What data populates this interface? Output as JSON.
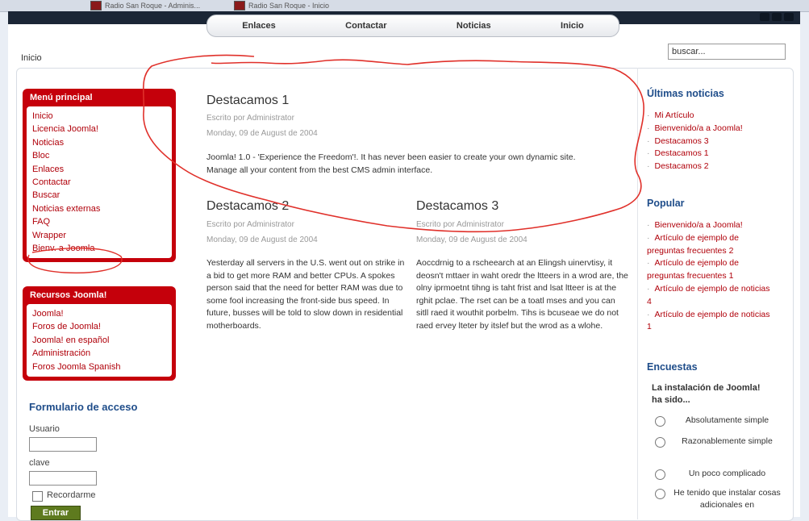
{
  "browser": {
    "tabs": [
      {
        "label": "Radio San Roque - Adminis..."
      },
      {
        "label": "Radio San Roque - Inicio"
      }
    ]
  },
  "nav": {
    "items": [
      "Enlaces",
      "Contactar",
      "Noticias",
      "Inicio"
    ]
  },
  "breadcrumb": "Inicio",
  "search": {
    "value": "buscar..."
  },
  "menu_principal": {
    "title": "Menú principal",
    "items": [
      "Inicio",
      "Licencia Joomla!",
      "Noticias",
      "Bloc",
      "Enlaces",
      "Contactar",
      "Buscar",
      "Noticias externas",
      "FAQ",
      "Wrapper",
      "Bienv. a Joomla"
    ]
  },
  "recursos": {
    "title": "Recursos Joomla!",
    "items": [
      "Joomla!",
      "Foros de Joomla!",
      "Joomla! en español",
      "Administración",
      "Foros Joomla Spanish"
    ]
  },
  "login": {
    "title": "Formulario de acceso",
    "user_label": "Usuario",
    "pass_label": "clave",
    "remember_label": "Recordarme",
    "submit_label": "Entrar"
  },
  "articles": [
    {
      "title": "Destacamos 1",
      "author": "Escrito por Administrator",
      "date": "Monday, 09 de August de 2004",
      "text": "Joomla! 1.0 - 'Experience the Freedom'!. It has never been easier to create your own dynamic site. Manage all your content from the best CMS admin interface."
    },
    {
      "title": "Destacamos 2",
      "author": "Escrito por Administrator",
      "date": "Monday, 09 de August de 2004",
      "text": "Yesterday all servers in the U.S. went out on strike in a bid to get more RAM and better CPUs. A spokes person said that the need for better RAM was due to some fool increasing the front-side bus speed. In future, busses will be told to slow down in residential motherboards."
    },
    {
      "title": "Destacamos 3",
      "author": "Escrito por Administrator",
      "date": "Monday, 09 de August de 2004",
      "text": "Aoccdrnig to a rscheearch at an Elingsh uinervtisy, it deosn't mttaer in waht oredr the ltteers in a wrod are, the olny iprmoetnt tihng is taht frist and lsat ltteer is at the rghit pclae. The rset can be a toatl mses and you can sitll raed it wouthit porbelm. Tihs is bcuseae we do not raed ervey lteter by itslef but the wrod as a wlohe."
    }
  ],
  "ultimas": {
    "title": "Últimas noticias",
    "items": [
      "Mi Artículo",
      "Bienvenido/a a Joomla!",
      "Destacamos 3",
      "Destacamos 1",
      "Destacamos 2"
    ]
  },
  "popular": {
    "title": "Popular",
    "items": [
      "Bienvenido/a a Joomla!",
      "Artículo de ejemplo de preguntas frecuentes 2",
      "Artículo de ejemplo de preguntas frecuentes 1",
      "Artículo de ejemplo de noticias 4",
      "Artículo de ejemplo de noticias 1"
    ]
  },
  "encuestas": {
    "title": "Encuestas",
    "question": "La instalación de Joomla! ha sido...",
    "options": [
      "Absolutamente simple",
      "Razonablemente simple",
      "Un poco complicado",
      "He tenido que instalar cosas adicionales en"
    ]
  },
  "colors": {
    "menu_red": "#c5000b",
    "link_red": "#b0000a",
    "heading_blue": "#1f4d8a",
    "annotation_red": "#e0302a"
  }
}
